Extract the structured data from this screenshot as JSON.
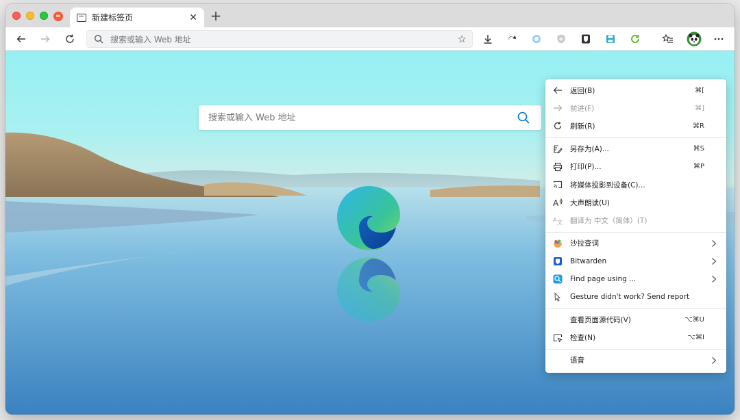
{
  "tab": {
    "title": "新建标签页",
    "close": "✕",
    "new_tab": "+",
    "profile_glyph": "∞"
  },
  "address": {
    "placeholder": "搜索或输入 Web 地址"
  },
  "page": {
    "search_placeholder": "搜索或输入 Web 地址"
  },
  "menu": {
    "groups": [
      [
        {
          "label": "返回(B)",
          "shortcut": "⌘[",
          "icon": "back-arrow-icon",
          "disabled": false
        },
        {
          "label": "前进(F)",
          "shortcut": "⌘]",
          "icon": "forward-arrow-icon",
          "disabled": true
        },
        {
          "label": "刷新(R)",
          "shortcut": "⌘R",
          "icon": "refresh-icon",
          "disabled": false
        }
      ],
      [
        {
          "label": "另存为(A)...",
          "shortcut": "⌘S",
          "icon": "save-as-icon",
          "disabled": false
        },
        {
          "label": "打印(P)...",
          "shortcut": "⌘P",
          "icon": "printer-icon",
          "disabled": false
        },
        {
          "label": "将媒体投影到设备(C)...",
          "shortcut": "",
          "icon": "cast-icon",
          "disabled": false
        },
        {
          "label": "大声朗读(U)",
          "shortcut": "",
          "icon": "read-aloud-icon",
          "disabled": false
        },
        {
          "label": "翻译为 中文（简体）(T)",
          "shortcut": "",
          "icon": "translate-icon",
          "disabled": true
        }
      ],
      [
        {
          "label": "沙拉查词",
          "shortcut": "",
          "icon": "saladict-icon",
          "disabled": false,
          "submenu": true
        },
        {
          "label": "Bitwarden",
          "shortcut": "",
          "icon": "bitwarden-icon",
          "disabled": false,
          "submenu": true
        },
        {
          "label": "Find page using ...",
          "shortcut": "",
          "icon": "find-page-icon",
          "disabled": false,
          "submenu": true
        },
        {
          "label": "Gesture didn't work? Send report",
          "shortcut": "",
          "icon": "gesture-icon",
          "disabled": false
        }
      ],
      [
        {
          "label": "查看页面源代码(V)",
          "shortcut": "⌥⌘U",
          "icon": "",
          "disabled": false
        },
        {
          "label": "检查(N)",
          "shortcut": "⌥⌘I",
          "icon": "inspect-icon",
          "disabled": false
        }
      ],
      [
        {
          "label": "语音",
          "shortcut": "",
          "icon": "",
          "disabled": false,
          "submenu": true
        }
      ]
    ]
  },
  "colors": {
    "accent": "#0078d4",
    "menu_disabled": "#9a9a9a"
  }
}
